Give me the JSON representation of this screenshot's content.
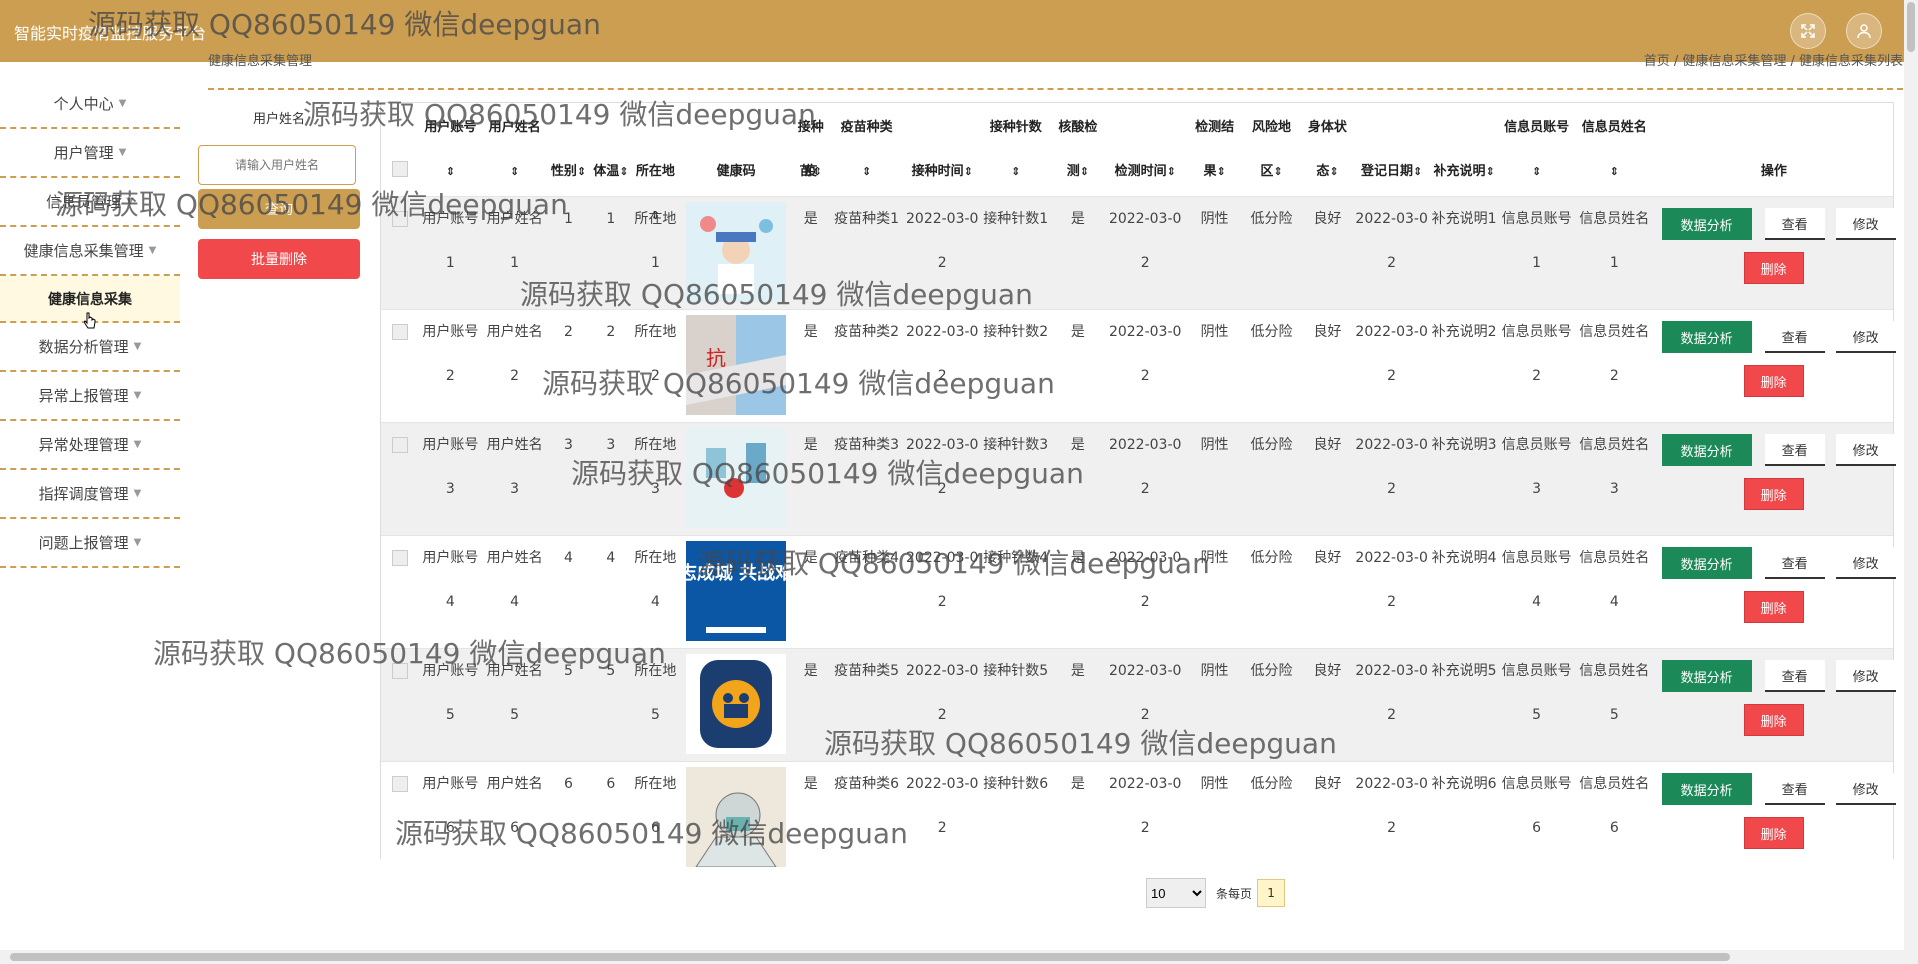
{
  "app": {
    "title": "智能实时疫情监控服务平台"
  },
  "breadcrumb": {
    "title": "健康信息采集管理",
    "path": "首页 / 健康信息采集管理 / 健康信息采集列表"
  },
  "sidebar": [
    {
      "label": "个人中心"
    },
    {
      "label": "用户管理"
    },
    {
      "label": "信息员管理"
    },
    {
      "label": "健康信息采集管理",
      "sub": "健康信息采集"
    },
    {
      "label": "数据分析管理"
    },
    {
      "label": "异常上报管理"
    },
    {
      "label": "异常处理管理"
    },
    {
      "label": "指挥调度管理"
    },
    {
      "label": "问题上报管理"
    }
  ],
  "search": {
    "label": "用户姓名",
    "placeholder": "请输入用户姓名",
    "query": "查询",
    "batch_delete": "批量删除"
  },
  "columns": [
    {
      "top": "用户账号",
      "bottom": ""
    },
    {
      "top": "用户姓名",
      "bottom": ""
    },
    {
      "top": "",
      "bottom": "性别"
    },
    {
      "top": "",
      "bottom": "体温"
    },
    {
      "top": "",
      "bottom": "所在地"
    },
    {
      "top": "",
      "bottom": "健康码"
    },
    {
      "top": "接种疫",
      "bottom": "苗"
    },
    {
      "top": "疫苗种类",
      "bottom": ""
    },
    {
      "top": "",
      "bottom": "接种时间"
    },
    {
      "top": "接种针数",
      "bottom": ""
    },
    {
      "top": "核酸检",
      "bottom": "测"
    },
    {
      "top": "",
      "bottom": "检测时间"
    },
    {
      "top": "检测结",
      "bottom": "果"
    },
    {
      "top": "风险地",
      "bottom": "区"
    },
    {
      "top": "身体状",
      "bottom": "态"
    },
    {
      "top": "",
      "bottom": "登记日期"
    },
    {
      "top": "",
      "bottom": "补充说明"
    },
    {
      "top": "信息员账号",
      "bottom": ""
    },
    {
      "top": "信息员姓名",
      "bottom": ""
    },
    {
      "top": "",
      "bottom": "操作"
    }
  ],
  "rows": [
    {
      "c": [
        "用户账号1",
        "用户姓名1",
        "1",
        "1",
        "所在地1",
        "",
        "是",
        "疫苗种类1",
        "2022-03-02",
        "接种针数1",
        "是",
        "2022-03-02",
        "阴性",
        "低分险",
        "良好",
        "2022-03-02",
        "补充说明1",
        "信息员账号1",
        "信息员姓名1"
      ],
      "img": "doctor"
    },
    {
      "c": [
        "用户账号2",
        "用户姓名2",
        "2",
        "2",
        "所在地2",
        "",
        "是",
        "疫苗种类2",
        "2022-03-02",
        "接种针数2",
        "是",
        "2022-03-02",
        "阴性",
        "低分险",
        "良好",
        "2022-03-02",
        "补充说明2",
        "信息员账号2",
        "信息员姓名2"
      ],
      "img": "mask"
    },
    {
      "c": [
        "用户账号3",
        "用户姓名3",
        "3",
        "3",
        "所在地3",
        "",
        "是",
        "疫苗种类3",
        "2022-03-02",
        "接种针数3",
        "是",
        "2022-03-02",
        "阴性",
        "低分险",
        "良好",
        "2022-03-02",
        "补充说明3",
        "信息员账号3",
        "信息员姓名3"
      ],
      "img": "lab"
    },
    {
      "c": [
        "用户账号4",
        "用户姓名4",
        "4",
        "4",
        "所在地4",
        "",
        "是",
        "疫苗种类4",
        "2022-03-02",
        "接种针数4",
        "是",
        "2022-03-02",
        "阴性",
        "低分险",
        "良好",
        "2022-03-02",
        "补充说明4",
        "信息员账号4",
        "信息员姓名4"
      ],
      "img": "poster",
      "img_text": "众志成城 共战难关"
    },
    {
      "c": [
        "用户账号5",
        "用户姓名5",
        "5",
        "5",
        "所在地5",
        "",
        "是",
        "疫苗种类5",
        "2022-03-02",
        "接种针数5",
        "是",
        "2022-03-02",
        "阴性",
        "低分险",
        "良好",
        "2022-03-02",
        "补充说明5",
        "信息员账号5",
        "信息员姓名5"
      ],
      "img": "people"
    },
    {
      "c": [
        "用户账号6",
        "用户姓名6",
        "6",
        "6",
        "所在地6",
        "",
        "是",
        "疫苗种类6",
        "2022-03-02",
        "接种针数6",
        "是",
        "2022-03-02",
        "阴性",
        "低分险",
        "良好",
        "2022-03-02",
        "补充说明6",
        "信息员账号6",
        "信息员姓名6"
      ],
      "img": "sketch"
    }
  ],
  "actions": {
    "analyze": "数据分析",
    "view": "查看",
    "edit": "修改",
    "delete": "删除"
  },
  "pager": {
    "size": "10",
    "per_page": "条每页",
    "page": "1"
  },
  "watermark_text": "源码获取 QQ86050149 微信deepguan",
  "colors": {
    "brand": "#cc9e52",
    "danger": "#f0484b",
    "success": "#1c8a58"
  }
}
